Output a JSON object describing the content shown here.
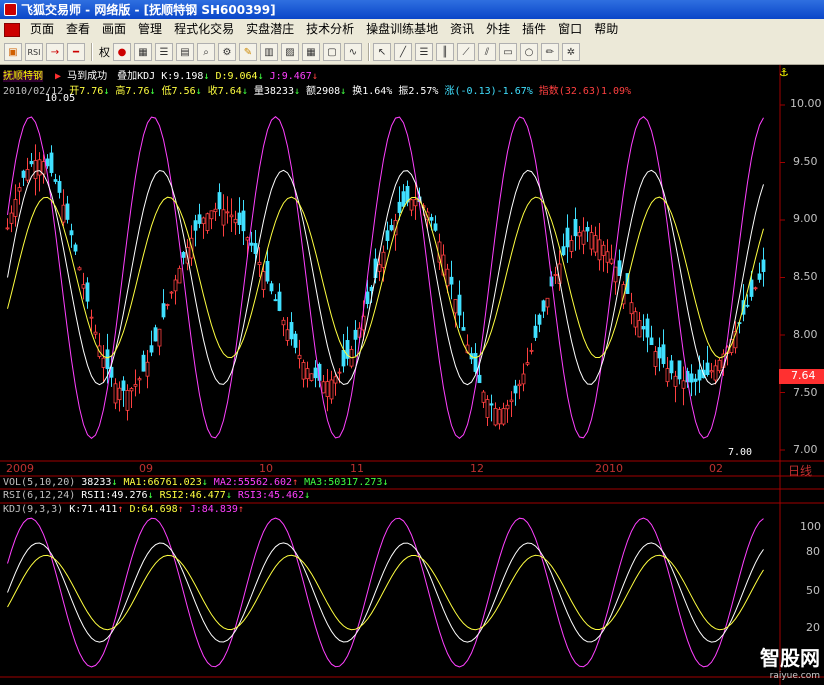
{
  "window": {
    "title": "飞狐交易师 - 网络版 - [抚顺特钢 SH600399]"
  },
  "menu": [
    "页面",
    "查看",
    "画面",
    "管理",
    "程式化交易",
    "实盘潜庄",
    "技术分析",
    "操盘训练基地",
    "资讯",
    "外挂",
    "插件",
    "窗口",
    "帮助"
  ],
  "toolbar": {
    "quan_label": "权"
  },
  "main": {
    "stock_name": "抚顺特钢",
    "formula": "马到成功",
    "overlay": "叠加KDJ",
    "k": "K:9.198",
    "d": "D:9.064",
    "j": "J:9.467",
    "date": "2010/02/12",
    "open": "开7.76",
    "high": "高7.76",
    "low": "低7.56",
    "close": "收7.64",
    "volume": "量38233",
    "amount": "额2908",
    "turnover": "换1.64%",
    "amplitude": "振2.57%",
    "change": "涨(-0.13)-1.67%",
    "index": "指数(32.63)1.09%",
    "max_label": "10.05",
    "min_label": "7.00",
    "last_price": "7.64",
    "period": "日线",
    "price_ticks": [
      "10.00",
      "9.50",
      "9.00",
      "8.50",
      "8.00",
      "7.50",
      "7.00"
    ],
    "dates": [
      "2009",
      "09",
      "10",
      "11",
      "12",
      "2010",
      "02"
    ]
  },
  "vol_panel": {
    "title": "VOL(5,10,20)",
    "vol": "38233",
    "ma1": "MA1:66761.023",
    "ma2": "MA2:55562.602",
    "ma3": "MA3:50317.273"
  },
  "rsi_panel": {
    "title": "RSI(6,12,24)",
    "rsi1": "RSI1:49.276",
    "rsi2": "RSI2:46.477",
    "rsi3": "RSI3:45.462"
  },
  "kdj_panel": {
    "title": "KDJ(9,3,3)",
    "k": "K:71.411",
    "d": "D:64.698",
    "j": "J:84.839",
    "ticks": [
      "100",
      "80",
      "50",
      "20"
    ]
  },
  "watermark": {
    "brand": "智股网",
    "url": "raiyue.com"
  },
  "colors": {
    "up": "#ff4040",
    "down": "#40e0ff",
    "k": "#ffffff",
    "d": "#ffff40",
    "j": "#ff40ff",
    "axis": "#a00000"
  }
}
